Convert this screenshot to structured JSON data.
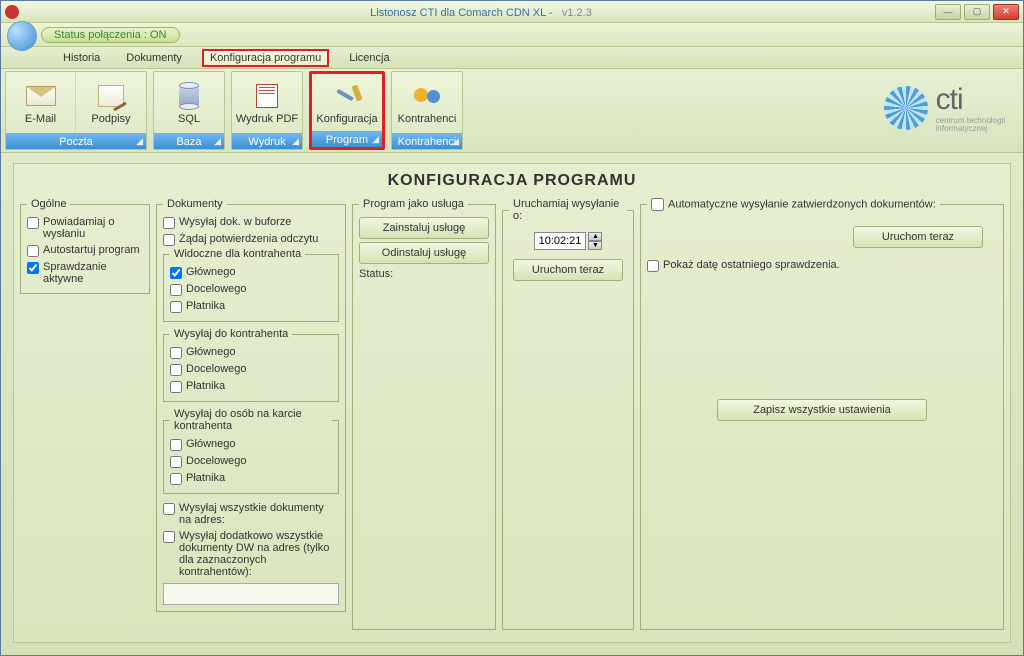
{
  "window": {
    "app_title": "Listonosz CTI dla Comarch CDN XL -",
    "version": "v1.2.3",
    "status_label": "Status połączenia : ON"
  },
  "menu": {
    "historia": "Historia",
    "dokumenty": "Dokumenty",
    "konfiguracja": "Konfiguracja programu",
    "licencja": "Licencja"
  },
  "ribbon": {
    "email": "E-Mail",
    "podpisy": "Podpisy",
    "sql": "SQL",
    "wydrukpdf": "Wydruk PDF",
    "konfiguracja": "Konfiguracja",
    "kontrahenci": "Kontrahenci",
    "g_poczta": "Poczta",
    "g_baza": "Baza",
    "g_wydruk": "Wydruk",
    "g_program": "Program",
    "g_kontrahenci": "Kontrahenci"
  },
  "page": {
    "title": "KONFIGURACJA PROGRAMU"
  },
  "ogolne": {
    "legend": "Ogólne",
    "powiadamiaj": {
      "label": "Powiadamiaj o wysłaniu",
      "checked": false
    },
    "autostart": {
      "label": "Autostartuj program",
      "checked": false
    },
    "sprawdzanie": {
      "label": "Sprawdzanie aktywne",
      "checked": true
    }
  },
  "dokumenty": {
    "legend": "Dokumenty",
    "bufor": {
      "label": "Wysyłaj dok. w buforze",
      "checked": false
    },
    "potwierdzenie": {
      "label": "Żądaj potwierdzenia odczytu",
      "checked": false
    },
    "widoczne": {
      "legend": "Widoczne dla kontrahenta",
      "glownego": {
        "label": "Głównego",
        "checked": true
      },
      "docelowego": {
        "label": "Docelowego",
        "checked": false
      },
      "platnika": {
        "label": "Płatnika",
        "checked": false
      }
    },
    "wysylaj_kontr": {
      "legend": "Wysyłaj do kontrahenta",
      "glownego": {
        "label": "Głównego",
        "checked": false
      },
      "docelowego": {
        "label": "Docelowego",
        "checked": false
      },
      "platnika": {
        "label": "Płatnika",
        "checked": false
      }
    },
    "wysylaj_osob": {
      "legend": "Wysyłaj do osób na karcie kontrahenta",
      "glownego": {
        "label": "Głównego",
        "checked": false
      },
      "docelowego": {
        "label": "Docelowego",
        "checked": false
      },
      "platnika": {
        "label": "Płatnika",
        "checked": false
      }
    },
    "wysylaj_adres": {
      "label": "Wysyłaj wszystkie dokumenty na adres:",
      "checked": false,
      "value": ""
    },
    "wysylaj_dw": {
      "label": "Wysyłaj dodatkowo wszystkie dokumenty DW na adres (tylko dla zaznaczonych kontrahentów):",
      "checked": false,
      "value": ""
    }
  },
  "usluga": {
    "legend": "Program jako usługa",
    "install": "Zainstaluj usługę",
    "uninstall": "Odinstaluj usługę",
    "status_label": "Status:"
  },
  "uruchamiaj": {
    "legend": "Uruchamiaj wysyłanie o:",
    "time": "10:02:21",
    "run": "Uruchom teraz"
  },
  "auto": {
    "legend": "Automatyczne wysyłanie zatwierdzonych dokumentów:",
    "enabled": false,
    "run": "Uruchom teraz",
    "show_date": {
      "label": "Pokaż datę ostatniego sprawdzenia.",
      "checked": false
    },
    "save": "Zapisz wszystkie ustawienia"
  },
  "logo": {
    "text": "cti",
    "sub1": "centrum technologii",
    "sub2": "informatycznej"
  }
}
